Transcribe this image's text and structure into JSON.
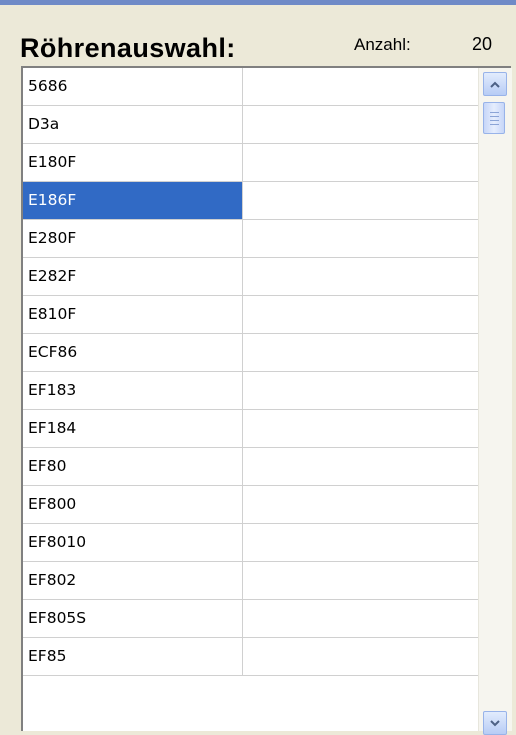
{
  "header": {
    "title": "Röhrenauswahl:",
    "count_label": "Anzahl:",
    "count_value": "20"
  },
  "list": {
    "selected_index": 3,
    "items": [
      "5686",
      "D3a",
      "E180F",
      "E186F",
      "E280F",
      "E282F",
      "E810F",
      "ECF86",
      "EF183",
      "EF184",
      "EF80",
      "EF800",
      "EF8010",
      "EF802",
      "EF805S",
      "EF85"
    ]
  },
  "scrollbar": {
    "up_icon": "chevron-up-icon",
    "down_icon": "chevron-down-icon"
  },
  "colors": {
    "selection": "#316AC5",
    "background": "#ECE9D8",
    "accent_border": "#6F8AC7"
  }
}
